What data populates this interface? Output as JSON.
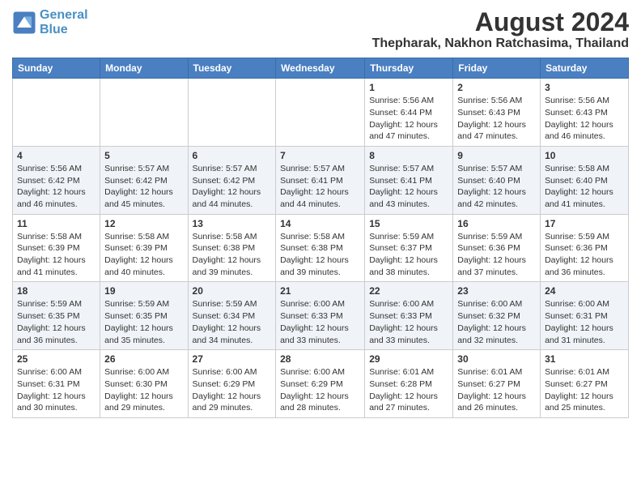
{
  "header": {
    "logo_line1": "General",
    "logo_line2": "Blue",
    "title": "August 2024",
    "subtitle": "Thepharak, Nakhon Ratchasima, Thailand"
  },
  "days_of_week": [
    "Sunday",
    "Monday",
    "Tuesday",
    "Wednesday",
    "Thursday",
    "Friday",
    "Saturday"
  ],
  "weeks": [
    [
      {
        "day": "",
        "info": ""
      },
      {
        "day": "",
        "info": ""
      },
      {
        "day": "",
        "info": ""
      },
      {
        "day": "",
        "info": ""
      },
      {
        "day": "1",
        "info": "Sunrise: 5:56 AM\nSunset: 6:44 PM\nDaylight: 12 hours\nand 47 minutes."
      },
      {
        "day": "2",
        "info": "Sunrise: 5:56 AM\nSunset: 6:43 PM\nDaylight: 12 hours\nand 47 minutes."
      },
      {
        "day": "3",
        "info": "Sunrise: 5:56 AM\nSunset: 6:43 PM\nDaylight: 12 hours\nand 46 minutes."
      }
    ],
    [
      {
        "day": "4",
        "info": "Sunrise: 5:56 AM\nSunset: 6:42 PM\nDaylight: 12 hours\nand 46 minutes."
      },
      {
        "day": "5",
        "info": "Sunrise: 5:57 AM\nSunset: 6:42 PM\nDaylight: 12 hours\nand 45 minutes."
      },
      {
        "day": "6",
        "info": "Sunrise: 5:57 AM\nSunset: 6:42 PM\nDaylight: 12 hours\nand 44 minutes."
      },
      {
        "day": "7",
        "info": "Sunrise: 5:57 AM\nSunset: 6:41 PM\nDaylight: 12 hours\nand 44 minutes."
      },
      {
        "day": "8",
        "info": "Sunrise: 5:57 AM\nSunset: 6:41 PM\nDaylight: 12 hours\nand 43 minutes."
      },
      {
        "day": "9",
        "info": "Sunrise: 5:57 AM\nSunset: 6:40 PM\nDaylight: 12 hours\nand 42 minutes."
      },
      {
        "day": "10",
        "info": "Sunrise: 5:58 AM\nSunset: 6:40 PM\nDaylight: 12 hours\nand 41 minutes."
      }
    ],
    [
      {
        "day": "11",
        "info": "Sunrise: 5:58 AM\nSunset: 6:39 PM\nDaylight: 12 hours\nand 41 minutes."
      },
      {
        "day": "12",
        "info": "Sunrise: 5:58 AM\nSunset: 6:39 PM\nDaylight: 12 hours\nand 40 minutes."
      },
      {
        "day": "13",
        "info": "Sunrise: 5:58 AM\nSunset: 6:38 PM\nDaylight: 12 hours\nand 39 minutes."
      },
      {
        "day": "14",
        "info": "Sunrise: 5:58 AM\nSunset: 6:38 PM\nDaylight: 12 hours\nand 39 minutes."
      },
      {
        "day": "15",
        "info": "Sunrise: 5:59 AM\nSunset: 6:37 PM\nDaylight: 12 hours\nand 38 minutes."
      },
      {
        "day": "16",
        "info": "Sunrise: 5:59 AM\nSunset: 6:36 PM\nDaylight: 12 hours\nand 37 minutes."
      },
      {
        "day": "17",
        "info": "Sunrise: 5:59 AM\nSunset: 6:36 PM\nDaylight: 12 hours\nand 36 minutes."
      }
    ],
    [
      {
        "day": "18",
        "info": "Sunrise: 5:59 AM\nSunset: 6:35 PM\nDaylight: 12 hours\nand 36 minutes."
      },
      {
        "day": "19",
        "info": "Sunrise: 5:59 AM\nSunset: 6:35 PM\nDaylight: 12 hours\nand 35 minutes."
      },
      {
        "day": "20",
        "info": "Sunrise: 5:59 AM\nSunset: 6:34 PM\nDaylight: 12 hours\nand 34 minutes."
      },
      {
        "day": "21",
        "info": "Sunrise: 6:00 AM\nSunset: 6:33 PM\nDaylight: 12 hours\nand 33 minutes."
      },
      {
        "day": "22",
        "info": "Sunrise: 6:00 AM\nSunset: 6:33 PM\nDaylight: 12 hours\nand 33 minutes."
      },
      {
        "day": "23",
        "info": "Sunrise: 6:00 AM\nSunset: 6:32 PM\nDaylight: 12 hours\nand 32 minutes."
      },
      {
        "day": "24",
        "info": "Sunrise: 6:00 AM\nSunset: 6:31 PM\nDaylight: 12 hours\nand 31 minutes."
      }
    ],
    [
      {
        "day": "25",
        "info": "Sunrise: 6:00 AM\nSunset: 6:31 PM\nDaylight: 12 hours\nand 30 minutes."
      },
      {
        "day": "26",
        "info": "Sunrise: 6:00 AM\nSunset: 6:30 PM\nDaylight: 12 hours\nand 29 minutes."
      },
      {
        "day": "27",
        "info": "Sunrise: 6:00 AM\nSunset: 6:29 PM\nDaylight: 12 hours\nand 29 minutes."
      },
      {
        "day": "28",
        "info": "Sunrise: 6:00 AM\nSunset: 6:29 PM\nDaylight: 12 hours\nand 28 minutes."
      },
      {
        "day": "29",
        "info": "Sunrise: 6:01 AM\nSunset: 6:28 PM\nDaylight: 12 hours\nand 27 minutes."
      },
      {
        "day": "30",
        "info": "Sunrise: 6:01 AM\nSunset: 6:27 PM\nDaylight: 12 hours\nand 26 minutes."
      },
      {
        "day": "31",
        "info": "Sunrise: 6:01 AM\nSunset: 6:27 PM\nDaylight: 12 hours\nand 25 minutes."
      }
    ]
  ]
}
